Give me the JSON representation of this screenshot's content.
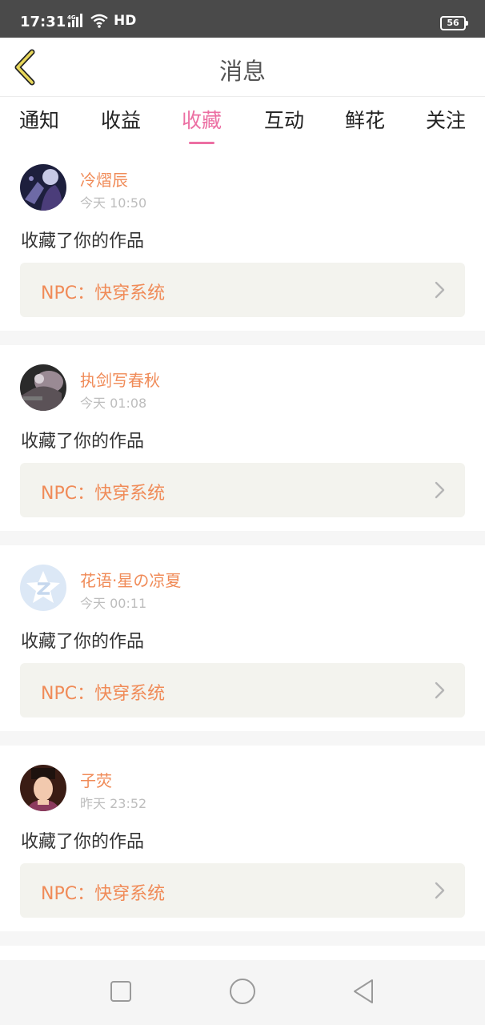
{
  "status": {
    "time": "17:31",
    "network": "4G",
    "hd": "HD",
    "battery": "56"
  },
  "header": {
    "title": "消息",
    "back_icon": "chevron-left-icon",
    "accent_color": "#e8d75a"
  },
  "tabs": [
    {
      "label": "通知",
      "active": false
    },
    {
      "label": "收益",
      "active": false
    },
    {
      "label": "收藏",
      "active": true
    },
    {
      "label": "互动",
      "active": false
    },
    {
      "label": "鲜花",
      "active": false
    },
    {
      "label": "关注",
      "active": false
    }
  ],
  "colors": {
    "active_tab": "#ec6fa3",
    "username": "#f08b58",
    "work_box_bg": "#f3f3ee"
  },
  "messages": [
    {
      "username": "冷熠辰",
      "time": "今天 10:50",
      "action": "收藏了你的作品",
      "work": "NPC：快穿系统"
    },
    {
      "username": "执剑写春秋",
      "time": "今天 01:08",
      "action": "收藏了你的作品",
      "work": "NPC：快穿系统"
    },
    {
      "username": "花语·星の凉夏",
      "time": "今天 00:11",
      "action": "收藏了你的作品",
      "work": "NPC：快穿系统"
    },
    {
      "username": "子荧",
      "time": "昨天 23:52",
      "action": "收藏了你的作品",
      "work": "NPC：快穿系统"
    }
  ],
  "navbar": {
    "icons": [
      "recents-square-icon",
      "home-circle-icon",
      "back-triangle-icon"
    ]
  }
}
